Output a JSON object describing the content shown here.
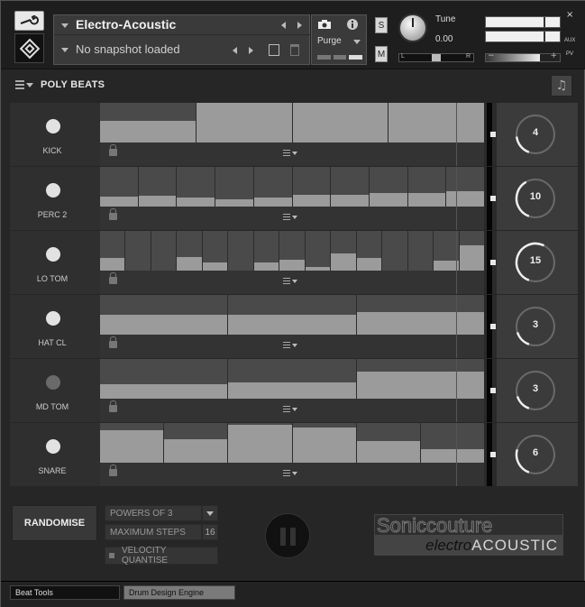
{
  "header": {
    "instrument_name": "Electro-Acoustic",
    "snapshot": "No snapshot loaded",
    "purge_label": "Purge",
    "solo_label": "S",
    "mute_label": "M",
    "tune_label": "Tune",
    "tune_value": "0.00",
    "pan_left": "L",
    "pan_right": "R",
    "aux_label": "AUX",
    "pv_label": "PV",
    "close_label": "×"
  },
  "title": "POLY BEATS",
  "tracks": [
    {
      "name": "KICK",
      "led": "on",
      "steps": 4,
      "levels": [
        0.55,
        1.0,
        1.0,
        1.0
      ]
    },
    {
      "name": "PERC 2",
      "led": "on",
      "steps": 10,
      "levels": [
        0.25,
        0.27,
        0.22,
        0.18,
        0.23,
        0.3,
        0.3,
        0.35,
        0.35,
        0.38
      ]
    },
    {
      "name": "LO TOM",
      "led": "on",
      "steps": 15,
      "levels": [
        0.32,
        0.0,
        0.0,
        0.33,
        0.2,
        0.0,
        0.2,
        0.27,
        0.08,
        0.43,
        0.32,
        0.0,
        0.0,
        0.25,
        0.63
      ]
    },
    {
      "name": "HAT CL",
      "led": "on",
      "steps": 3,
      "levels": [
        0.5,
        0.5,
        0.57
      ]
    },
    {
      "name": "MD TOM",
      "led": "dim",
      "steps": 3,
      "levels": [
        0.37,
        0.42,
        0.68
      ]
    },
    {
      "name": "SNARE",
      "led": "on",
      "steps": 6,
      "levels": [
        0.82,
        0.6,
        0.95,
        0.88,
        0.55,
        0.35
      ]
    }
  ],
  "bottom": {
    "randomise_label": "RANDOMISE",
    "powers_label": "POWERS OF 3",
    "max_steps_label": "MAXIMUM STEPS",
    "max_steps_value": "16",
    "velocity_label": "VELOCITY QUANTISE",
    "brand_top": "Soniccouture",
    "brand_electro": "electro",
    "brand_acoustic": "ACOUSTIC"
  },
  "tabs": [
    "Beat Tools",
    "Drum Design Engine"
  ],
  "colors": {
    "step_fill": "#9b9b9b",
    "step_bg": "#4a4a4a",
    "led_on": "#e2e2e2",
    "led_dim": "#6a6a6a"
  }
}
